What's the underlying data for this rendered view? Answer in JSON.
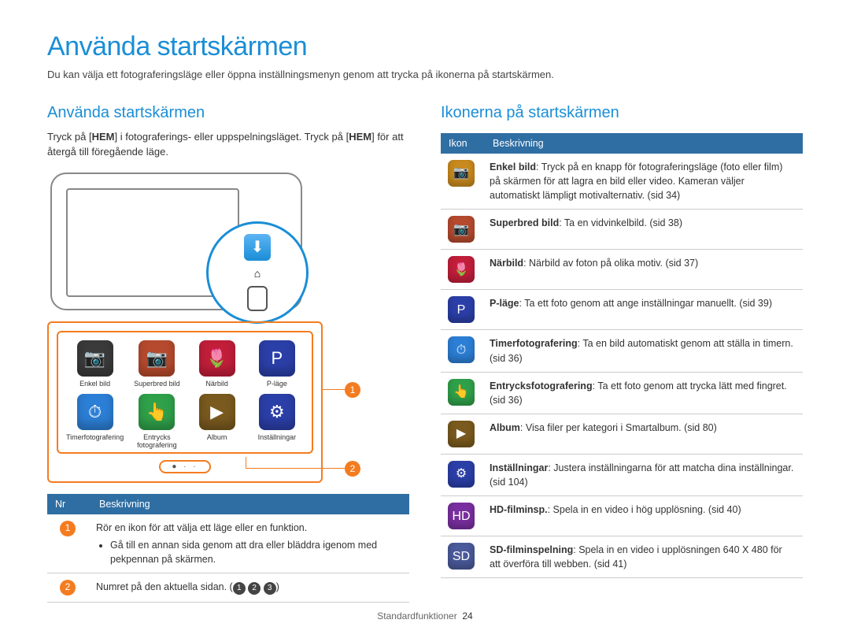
{
  "page": {
    "title": "Använda startskärmen",
    "intro": "Du kan välja ett fotograferingsläge eller öppna inställningsmenyn genom att trycka på ikonerna på startskärmen."
  },
  "left": {
    "heading": "Använda startskärmen",
    "para_before_hem1": "Tryck på [",
    "hem1": "HEM",
    "para_mid": "] i fotograferings- eller uppspelningsläget. Tryck på [",
    "hem2": "HEM",
    "para_after": "] för att återgå till föregående läge.",
    "grid": [
      {
        "label": "Enkel bild",
        "glyph": "📷",
        "bg": "#3a3a3a"
      },
      {
        "label": "Superbred bild",
        "glyph": "📷",
        "bg": "#b64a2e"
      },
      {
        "label": "Närbild",
        "glyph": "🌷",
        "bg": "#c21e3a"
      },
      {
        "label": "P-läge",
        "glyph": "P",
        "bg": "#2b3fa8"
      },
      {
        "label": "Timerfotografering",
        "glyph": "⏱",
        "bg": "#2c7fd6"
      },
      {
        "label": "Entrycks fotografering",
        "glyph": "👆",
        "bg": "#2fa14a"
      },
      {
        "label": "Album",
        "glyph": "▶",
        "bg": "#7a5a1e"
      },
      {
        "label": "Inställningar",
        "glyph": "⚙",
        "bg": "#2b3fa8"
      }
    ],
    "indicator": "● · ·",
    "callouts": {
      "one": "1",
      "two": "2"
    },
    "table": {
      "head": [
        "Nr",
        "Beskrivning"
      ],
      "rows": [
        {
          "num": "1",
          "text": "Rör en ikon för att välja ett läge eller en funktion.",
          "bullet": "Gå till en annan sida genom att dra eller bläddra igenom med pekpennan på skärmen."
        },
        {
          "num": "2",
          "text": "Numret på den aktuella sidan. (",
          "badges": [
            "1",
            "2",
            "3"
          ],
          "text_after": ")"
        }
      ]
    }
  },
  "right": {
    "heading": "Ikonerna på startskärmen",
    "head": [
      "Ikon",
      "Beskrivning"
    ],
    "rows": [
      {
        "glyph": "📷",
        "bg": "#c98a1e",
        "bold": "Enkel bild",
        "text": ": Tryck på en knapp för fotograferingsläge (foto eller film) på skärmen för att lagra en bild eller video. Kameran väljer automatiskt lämpligt motivalternativ. (sid 34)"
      },
      {
        "glyph": "📷",
        "bg": "#b64a2e",
        "bold": "Superbred bild",
        "text": ": Ta en vidvinkelbild. (sid 38)"
      },
      {
        "glyph": "🌷",
        "bg": "#c21e3a",
        "bold": "Närbild",
        "text": ": Närbild av foton på olika motiv. (sid 37)"
      },
      {
        "glyph": "P",
        "bg": "#2b3fa8",
        "bold": "P-läge",
        "text": ": Ta ett foto genom att ange inställningar manuellt. (sid 39)"
      },
      {
        "glyph": "⏱",
        "bg": "#2c7fd6",
        "bold": "Timerfotografering",
        "text": ": Ta en bild automatiskt genom att ställa in timern. (sid 36)"
      },
      {
        "glyph": "👆",
        "bg": "#2fa14a",
        "bold": "Entrycksfotografering",
        "text": ": Ta ett foto genom att trycka lätt med fingret. (sid 36)"
      },
      {
        "glyph": "▶",
        "bg": "#7a5a1e",
        "bold": "Album",
        "text": ": Visa filer per kategori i Smartalbum. (sid 80)"
      },
      {
        "glyph": "⚙",
        "bg": "#2b3fa8",
        "bold": "Inställningar",
        "text": ": Justera inställningarna för att matcha dina inställningar. (sid 104)"
      },
      {
        "glyph": "HD",
        "bg": "#7a2fa0",
        "bold": "HD-filminsp.",
        "text": ": Spela in en video i hög upplösning. (sid 40)"
      },
      {
        "glyph": "SD",
        "bg": "#4a5a9a",
        "bold": "SD-filminspelning",
        "text": ": Spela in en video i upplösningen 640 X 480 för att överföra till webben. (sid 41)"
      }
    ]
  },
  "footer": {
    "section": "Standardfunktioner",
    "page": "24"
  }
}
